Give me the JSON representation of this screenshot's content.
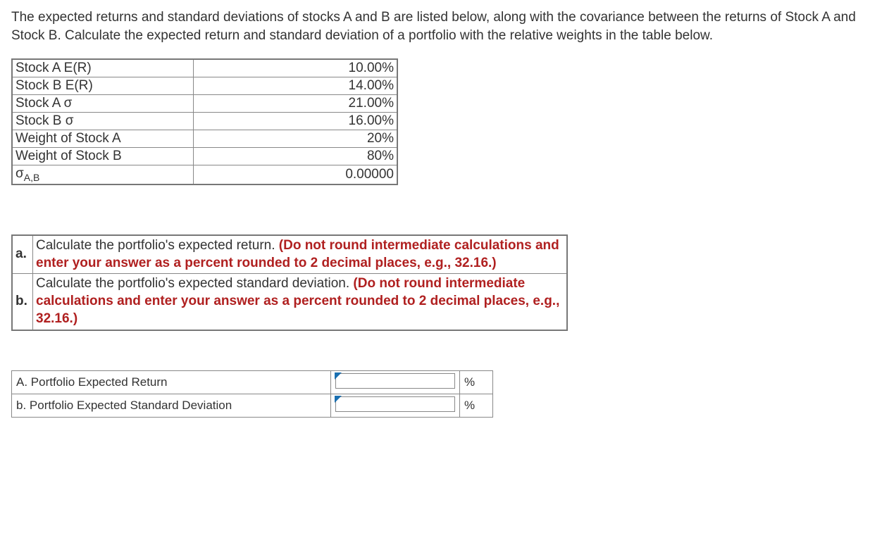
{
  "question": "The expected returns and standard deviations of stocks A and B are listed below, along with the covariance between the returns of Stock A and Stock B.  Calculate the expected return and standard deviation of a portfolio with the relative weights in the table below.",
  "data_rows": [
    {
      "label": "Stock A E(R)",
      "value": "10.00%"
    },
    {
      "label": "Stock B E(R)",
      "value": "14.00%"
    },
    {
      "label": "Stock A σ",
      "value": "21.00%"
    },
    {
      "label": "Stock B σ",
      "value": "16.00%"
    },
    {
      "label": "Weight of Stock A",
      "value": "20%"
    },
    {
      "label": "Weight of Stock B",
      "value": "80%"
    }
  ],
  "cov_row": {
    "label_sigma": "σ",
    "label_sub": "A,B",
    "value": "0.00000"
  },
  "parts": {
    "a": {
      "letter": "a.",
      "lead": "Calculate the portfolio's expected return.  ",
      "note": "(Do not round intermediate calculations and enter your answer as a percent rounded to 2 decimal places, e.g., 32.16.)"
    },
    "b": {
      "letter": "b.",
      "lead": "Calculate the portfolio's expected standard deviation.  ",
      "note": "(Do not round intermediate calculations and enter your answer as a percent rounded to 2 decimal places, e.g., 32.16.)"
    }
  },
  "answers": {
    "a": {
      "label": "A. Portfolio Expected Return",
      "unit": "%"
    },
    "b": {
      "label": "b. Portfolio Expected Standard Deviation",
      "unit": "%"
    }
  }
}
